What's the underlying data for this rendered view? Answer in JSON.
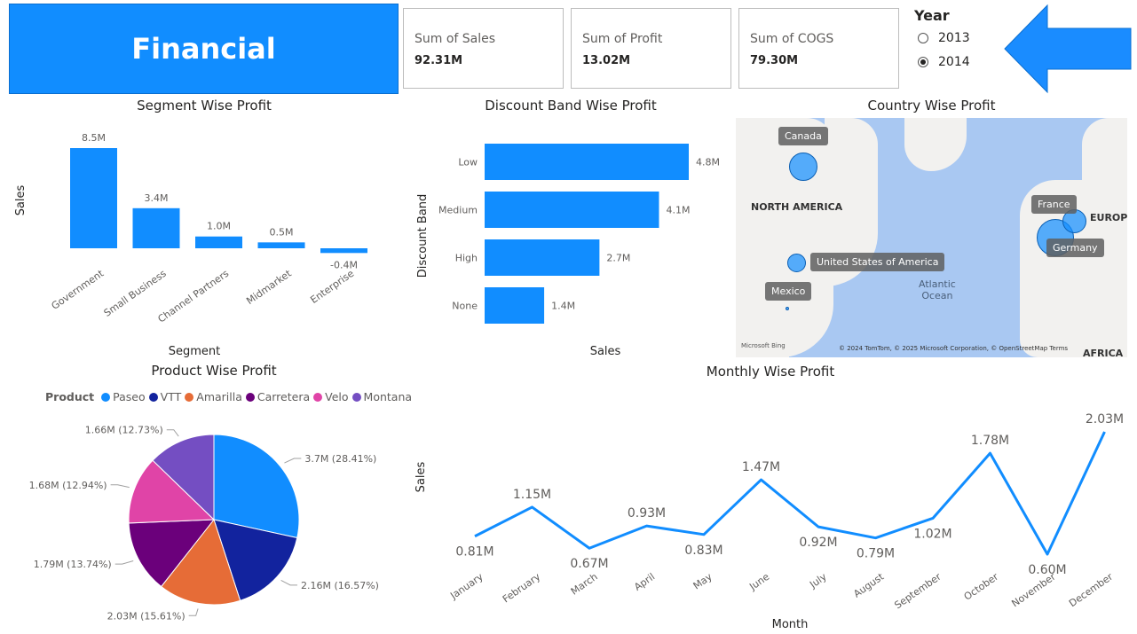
{
  "header": {
    "title": "Financial"
  },
  "cards": [
    {
      "label": "Sum of Sales",
      "value": "92.31M"
    },
    {
      "label": "Sum of Profit",
      "value": "13.02M"
    },
    {
      "label": "Sum of COGS",
      "value": "79.30M"
    }
  ],
  "year_slicer": {
    "title": "Year",
    "options": [
      "2013",
      "2014"
    ],
    "selected": "2014"
  },
  "colors": {
    "accent": "#118DFF",
    "arrow": "#1a8cff"
  },
  "chart_data": [
    {
      "id": "segment",
      "type": "bar",
      "title": "Segment Wise Profit",
      "xlabel": "Segment",
      "ylabel": "Sales",
      "categories": [
        "Government",
        "Small Business",
        "Channel Partners",
        "Midmarket",
        "Enterprise"
      ],
      "values": [
        8.5,
        3.4,
        1.0,
        0.5,
        -0.4
      ],
      "labels": [
        "8.5M",
        "3.4M",
        "1.0M",
        "0.5M",
        "-0.4M"
      ],
      "ylim": [
        -0.4,
        8.5
      ]
    },
    {
      "id": "discount",
      "type": "bar",
      "orientation": "horizontal",
      "title": "Discount Band Wise Profit",
      "xlabel": "Sales",
      "ylabel": "Discount Band",
      "categories": [
        "Low",
        "Medium",
        "High",
        "None"
      ],
      "values": [
        4.8,
        4.1,
        2.7,
        1.4
      ],
      "labels": [
        "4.8M",
        "4.1M",
        "2.7M",
        "1.4M"
      ]
    },
    {
      "id": "country",
      "type": "map",
      "title": "Country Wise Profit",
      "points": [
        {
          "name": "Canada"
        },
        {
          "name": "France"
        },
        {
          "name": "Germany"
        },
        {
          "name": "United States of America"
        },
        {
          "name": "Mexico"
        }
      ],
      "map_labels": [
        "NORTH AMERICA",
        "EUROPE",
        "AFRICA"
      ],
      "ocean_label": [
        "Atlantic",
        "Ocean"
      ],
      "attribution": "© 2024 TomTom, © 2025 Microsoft Corporation, © OpenStreetMap  Terms",
      "provider": "Microsoft Bing"
    },
    {
      "id": "product",
      "type": "pie",
      "title": "Product Wise Profit",
      "legend_title": "Product",
      "slices": [
        {
          "name": "Paseo",
          "value": 3.7,
          "label": "3.7M (28.41%)",
          "color": "#118DFF"
        },
        {
          "name": "VTT",
          "value": 2.16,
          "label": "2.16M (16.57%)",
          "color": "#12239E"
        },
        {
          "name": "Amarilla",
          "value": 2.03,
          "label": "2.03M (15.61%)",
          "color": "#E66C37"
        },
        {
          "name": "Carretera",
          "value": 1.79,
          "label": "1.79M (13.74%)",
          "color": "#6B007B"
        },
        {
          "name": "Velo",
          "value": 1.68,
          "label": "1.68M (12.94%)",
          "color": "#E044A7"
        },
        {
          "name": "Montana",
          "value": 1.66,
          "label": "1.66M (12.73%)",
          "color": "#744EC2"
        }
      ]
    },
    {
      "id": "monthly",
      "type": "line",
      "title": "Monthly Wise Profit",
      "xlabel": "Month",
      "ylabel": "Sales",
      "categories": [
        "January",
        "February",
        "March",
        "April",
        "May",
        "June",
        "July",
        "August",
        "September",
        "October",
        "November",
        "December"
      ],
      "values": [
        0.81,
        1.15,
        0.67,
        0.93,
        0.83,
        1.47,
        0.92,
        0.79,
        1.02,
        1.78,
        0.6,
        2.03
      ],
      "labels": [
        "0.81M",
        "1.15M",
        "0.67M",
        "0.93M",
        "0.83M",
        "1.47M",
        "0.92M",
        "0.79M",
        "1.02M",
        "1.78M",
        "0.60M",
        "2.03M"
      ]
    }
  ]
}
